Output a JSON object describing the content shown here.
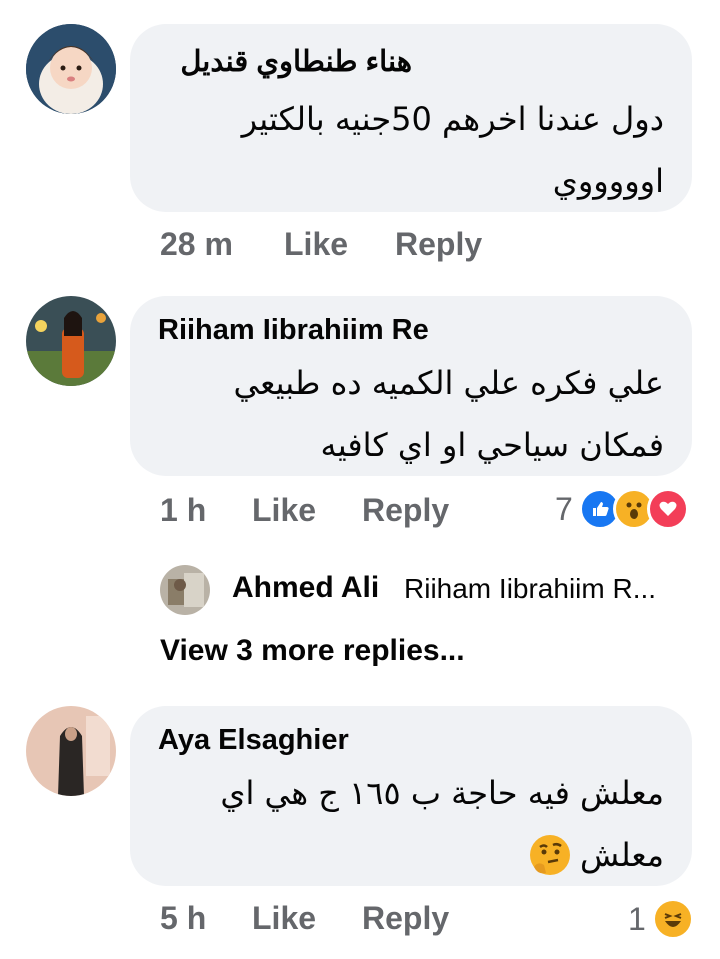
{
  "comments": [
    {
      "author": "هناء طنطاوي قنديل",
      "lines": [
        "دول عندنا اخرهم 50جنيه بالكتير",
        "اوووووي"
      ],
      "time": "28 m",
      "like_label": "Like",
      "reply_label": "Reply"
    },
    {
      "author": "Riiham Iibrahiim Re",
      "lines": [
        "علي فكره  علي الكميه ده طبيعي",
        "فمكان سياحي   او اي كافيه"
      ],
      "time": "1 h",
      "like_label": "Like",
      "reply_label": "Reply",
      "reaction_count": "7",
      "reactions": [
        "like-icon",
        "wow-icon",
        "love-icon"
      ]
    },
    {
      "author": "Aya Elsaghier",
      "lines": [
        "معلش فيه حاجة ب ١٦٥ ج هي اي",
        "معلش"
      ],
      "emoji": "thinking-face-icon",
      "time": "5 h",
      "like_label": "Like",
      "reply_label": "Reply",
      "reaction_count": "1",
      "reactions": [
        "haha-icon"
      ]
    }
  ],
  "reply_preview": {
    "author": "Ahmed Ali",
    "text": "Riiham Iibrahiim R..."
  },
  "view_more_label": "View 3 more replies...",
  "colors": {
    "bubble": "#f0f2f5",
    "meta": "#65676b",
    "like_blue": "#1877f2",
    "love_red": "#f33e58",
    "emoji_yellow": "#f7b125"
  }
}
